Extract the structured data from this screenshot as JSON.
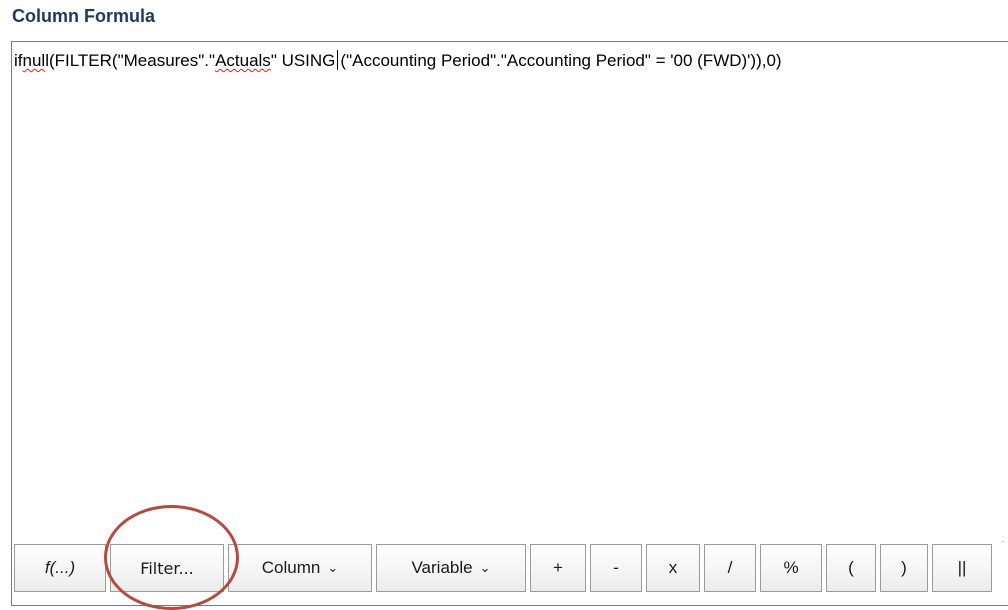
{
  "heading": "Column Formula",
  "formula": {
    "part1": "if",
    "part2": "nul",
    "part3": "l(FILTER(\"Measures\".\"",
    "part4": "Actuals",
    "part5": "\" USING",
    "part6": "(\"Accounting Period\".\"Accounting Period\" = '00 (FWD)')),0)"
  },
  "toolbar": {
    "function_label": "f(...)",
    "filter_label": "Filter...",
    "column_label": "Column",
    "variable_label": "Variable",
    "plus_label": "+",
    "minus_label": "-",
    "multiply_label": "x",
    "divide_label": "/",
    "percent_label": "%",
    "open_paren_label": "(",
    "close_paren_label": ")",
    "concat_label": "||",
    "dropdown_icon": "chevron-down-icon"
  },
  "colors": {
    "heading": "#1e3a63",
    "spellcheck_underline": "#e02020",
    "highlight_ring": "#b8493d"
  }
}
